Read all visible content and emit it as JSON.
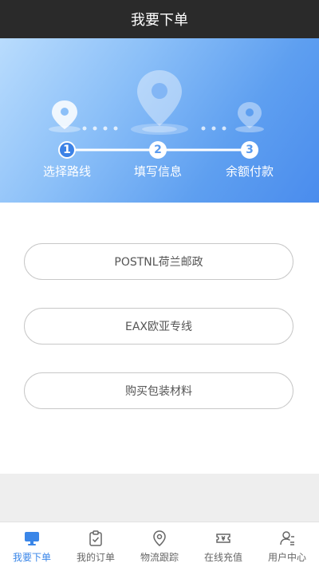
{
  "header": {
    "title": "我要下单"
  },
  "steps": [
    {
      "number": "1",
      "label": "选择路线",
      "active": true
    },
    {
      "number": "2",
      "label": "填写信息",
      "active": false
    },
    {
      "number": "3",
      "label": "余额付款",
      "active": false
    }
  ],
  "options": [
    {
      "label": "POSTNL荷兰邮政"
    },
    {
      "label": "EAX欧亚专线"
    },
    {
      "label": "购买包装材料"
    }
  ],
  "tabbar": {
    "items": [
      {
        "label": "我要下单",
        "icon": "monitor-icon",
        "active": true
      },
      {
        "label": "我的订单",
        "icon": "clipboard-icon",
        "active": false
      },
      {
        "label": "物流跟踪",
        "icon": "location-pin-icon",
        "active": false
      },
      {
        "label": "在线充值",
        "icon": "ticket-icon",
        "active": false
      },
      {
        "label": "用户中心",
        "icon": "user-icon",
        "active": false
      }
    ]
  },
  "colors": {
    "accent": "#3a86e8",
    "header_bg": "#2a2a2a",
    "hero_start": "#b9dcfd",
    "hero_end": "#4a8ced"
  }
}
